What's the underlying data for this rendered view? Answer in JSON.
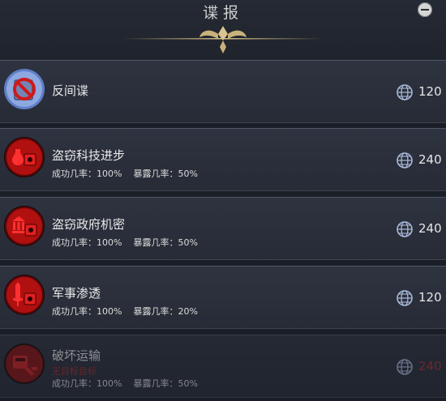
{
  "header": {
    "title": "谍报"
  },
  "colors": {
    "accent_gold": "#c8b27a",
    "danger_red": "#c01515",
    "shield_blue": "#5f7fc8"
  },
  "actions": [
    {
      "title": "反间谍",
      "cost": "120",
      "icon": "counter-espionage-icon",
      "disabled": false
    },
    {
      "title": "盗窃科技进步",
      "success_label": "成功几率：100%",
      "exposure_label": "暴露几率：50%",
      "cost": "240",
      "icon": "steal-tech-icon",
      "disabled": false
    },
    {
      "title": "盗窃政府机密",
      "success_label": "成功几率：100%",
      "exposure_label": "暴露几率：50%",
      "cost": "240",
      "icon": "steal-government-secrets-icon",
      "disabled": false
    },
    {
      "title": "军事渗透",
      "success_label": "成功几率：100%",
      "exposure_label": "暴露几率：20%",
      "cost": "120",
      "icon": "military-infiltration-icon",
      "disabled": false
    },
    {
      "title": "破坏运输",
      "sub": "无目标目标",
      "success_label": "成功几率：100%",
      "exposure_label": "暴露几率：50%",
      "cost": "240",
      "icon": "sabotage-transport-icon",
      "disabled": true
    }
  ]
}
